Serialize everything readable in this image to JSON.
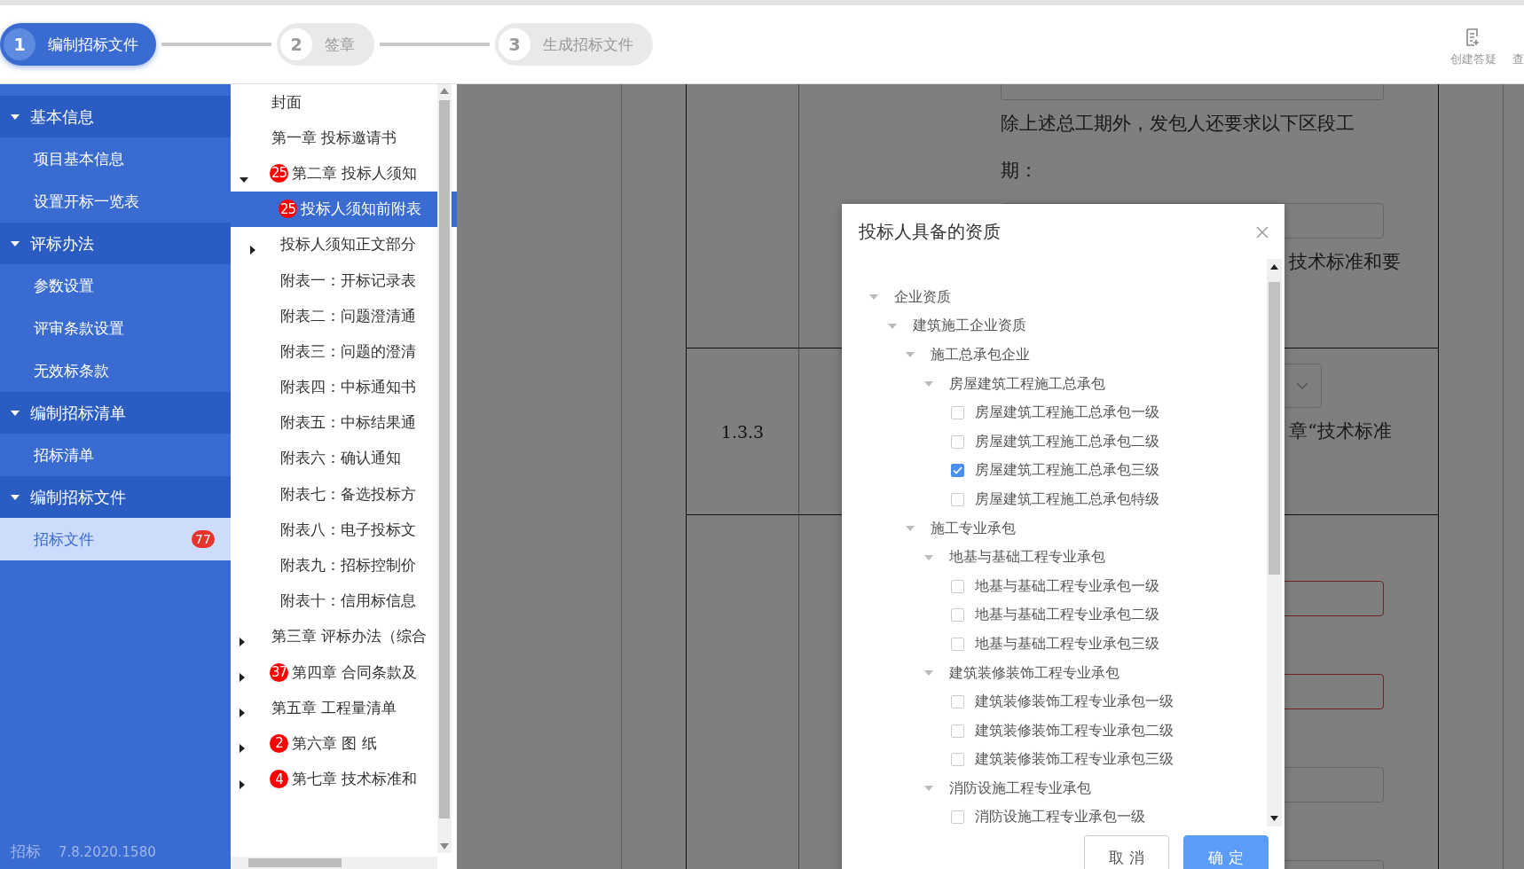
{
  "steps": [
    {
      "number": "1",
      "label": "编制招标文件",
      "selected": true
    },
    {
      "number": "2",
      "label": "签章",
      "selected": false
    },
    {
      "number": "3",
      "label": "生成招标文件",
      "selected": false
    }
  ],
  "toolbar": [
    {
      "label": "创建答疑",
      "kind": "create"
    },
    {
      "label": "查",
      "kind": "none"
    }
  ],
  "sidebar": {
    "sections": [
      {
        "title": "基本信息",
        "expanded": true,
        "items": [
          {
            "label": "项目基本信息",
            "selected": false
          },
          {
            "label": "设置开标一览表",
            "selected": false
          }
        ]
      },
      {
        "title": "评标办法",
        "expanded": true,
        "items": [
          {
            "label": "参数设置",
            "selected": false
          },
          {
            "label": "评审条款设置",
            "selected": false
          },
          {
            "label": "无效标条款",
            "selected": false
          }
        ]
      },
      {
        "title": "编制招标清单",
        "expanded": true,
        "items": [
          {
            "label": "招标清单",
            "selected": false
          }
        ]
      },
      {
        "title": "编制招标文件",
        "expanded": true,
        "items": [
          {
            "label": "招标文件",
            "selected": true,
            "badge": "77"
          }
        ]
      }
    ],
    "footer_name": "招标",
    "footer_version": "7.8.2020.1580"
  },
  "outline": [
    {
      "label": "封面",
      "selected": false
    },
    {
      "label": "第一章 投标邀请书",
      "selected": false
    },
    {
      "label": "第二章 投标人须知",
      "badge": "25",
      "selected": false,
      "expanded": true,
      "children": [
        {
          "label": "投标人须知前附表",
          "badge": "25",
          "selected": true
        },
        {
          "label": "投标人须知正文部分",
          "selected": false,
          "expanded": false
        },
        {
          "label": "附表一：开标记录表",
          "selected": false
        },
        {
          "label": "附表二：问题澄清通",
          "selected": false
        },
        {
          "label": "附表三：问题的澄清",
          "selected": false
        },
        {
          "label": "附表四：中标通知书",
          "selected": false
        },
        {
          "label": "附表五：中标结果通",
          "selected": false
        },
        {
          "label": "附表六：确认通知",
          "selected": false
        },
        {
          "label": "附表七：备选投标方",
          "selected": false
        },
        {
          "label": "附表八：电子投标文",
          "selected": false
        },
        {
          "label": "附表九：招标控制价",
          "selected": false
        },
        {
          "label": "附表十：信用标信息",
          "selected": false
        }
      ]
    },
    {
      "label": "第三章 评标办法（综合",
      "selected": false,
      "expanded": false
    },
    {
      "label": "第四章 合同条款及",
      "badge": "37",
      "selected": false,
      "expanded": false
    },
    {
      "label": "第五章 工程量清单",
      "selected": false,
      "expanded": false
    },
    {
      "label": "第六章 图  纸",
      "badge": "2",
      "selected": false,
      "expanded": false
    },
    {
      "label": "第七章 技术标准和",
      "badge": "4",
      "selected": false,
      "expanded": false
    }
  ],
  "document": {
    "rows": [
      {
        "number": "",
        "blocks": [
          {
            "kind": "field",
            "invalid": false
          },
          {
            "kind": "text",
            "text": "除上述总工期外，发包人还要求以下区段工"
          },
          {
            "kind": "text",
            "text": "期："
          },
          {
            "kind": "field",
            "invalid": false
          },
          {
            "kind": "tail",
            "text": "技术标准和要"
          }
        ]
      },
      {
        "number": "1.3.3",
        "blocks": [
          {
            "kind": "select"
          },
          {
            "kind": "tail",
            "text": "章“技术标准"
          }
        ]
      },
      {
        "number": "",
        "blocks": [
          {
            "kind": "field",
            "invalid": true
          },
          {
            "kind": "field",
            "invalid": true
          },
          {
            "kind": "field",
            "invalid": false
          },
          {
            "kind": "field",
            "invalid": false
          }
        ]
      }
    ]
  },
  "dialog": {
    "title": "投标人具备的资质",
    "tree": [
      {
        "label": "企业资质",
        "expanded": true,
        "children": [
          {
            "label": "建筑施工企业资质",
            "expanded": true,
            "children": [
              {
                "label": "施工总承包企业",
                "expanded": true,
                "children": [
                  {
                    "label": "房屋建筑工程施工总承包",
                    "expanded": true,
                    "children": [
                      {
                        "label": "房屋建筑工程施工总承包一级",
                        "checked": false
                      },
                      {
                        "label": "房屋建筑工程施工总承包二级",
                        "checked": false
                      },
                      {
                        "label": "房屋建筑工程施工总承包三级",
                        "checked": true
                      },
                      {
                        "label": "房屋建筑工程施工总承包特级",
                        "checked": false
                      }
                    ]
                  }
                ]
              },
              {
                "label": "施工专业承包",
                "expanded": true,
                "children": [
                  {
                    "label": "地基与基础工程专业承包",
                    "expanded": true,
                    "children": [
                      {
                        "label": "地基与基础工程专业承包一级",
                        "checked": false
                      },
                      {
                        "label": "地基与基础工程专业承包二级",
                        "checked": false
                      },
                      {
                        "label": "地基与基础工程专业承包三级",
                        "checked": false
                      }
                    ]
                  },
                  {
                    "label": "建筑装修装饰工程专业承包",
                    "expanded": true,
                    "children": [
                      {
                        "label": "建筑装修装饰工程专业承包一级",
                        "checked": false
                      },
                      {
                        "label": "建筑装修装饰工程专业承包二级",
                        "checked": false
                      },
                      {
                        "label": "建筑装修装饰工程专业承包三级",
                        "checked": false
                      }
                    ]
                  },
                  {
                    "label": "消防设施工程专业承包",
                    "expanded": true,
                    "children": [
                      {
                        "label": "消防设施工程专业承包一级",
                        "checked": false
                      }
                    ]
                  }
                ]
              }
            ]
          }
        ]
      }
    ],
    "buttons": [
      {
        "label": "取 消",
        "kind": "secondary"
      },
      {
        "label": "确 定",
        "kind": "primary"
      }
    ]
  }
}
